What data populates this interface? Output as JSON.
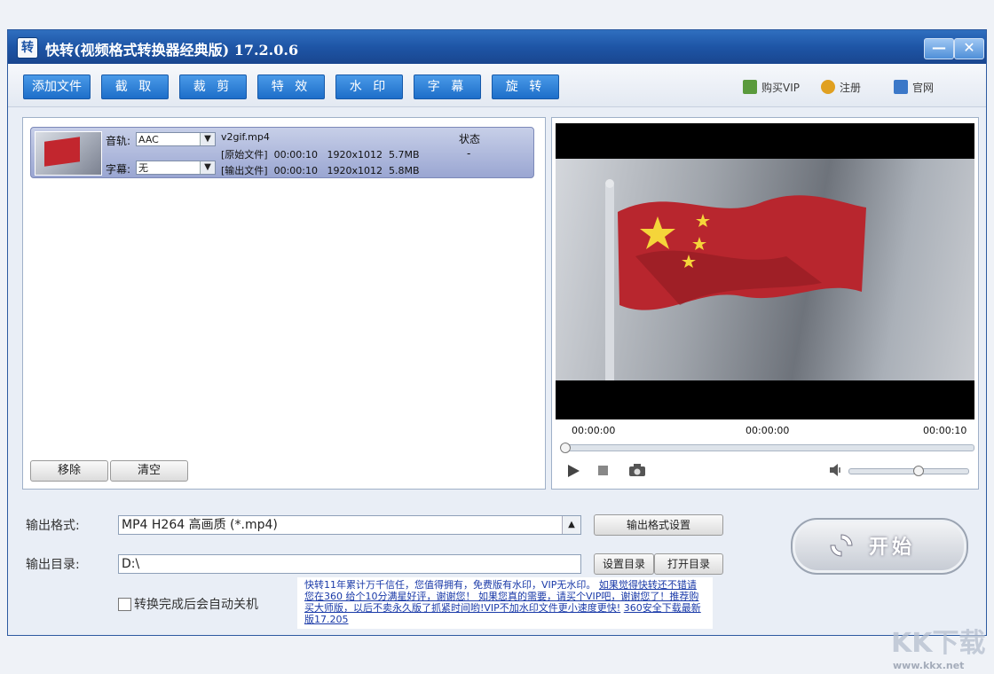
{
  "window": {
    "title": "快转(视频格式转换器经典版) 17.2.0.6",
    "app_icon_glyph": "转",
    "minimize_glyph": "—",
    "close_glyph": "✕"
  },
  "toolbar": {
    "buttons": [
      "添加文件",
      "截 取",
      "裁 剪",
      "特 效",
      "水 印",
      "字 幕",
      "旋 转"
    ],
    "links": [
      {
        "label": "购买VIP",
        "icon": "cart-icon"
      },
      {
        "label": "注册",
        "icon": "medal-icon"
      },
      {
        "label": "官网",
        "icon": "home-icon"
      }
    ]
  },
  "file_list": {
    "items": [
      {
        "audio_label": "音轨:",
        "audio_value": "AAC",
        "subtitle_label": "字幕:",
        "subtitle_value": "无",
        "filename": "v2gif.mp4",
        "source_info": "[原始文件]  00:00:10   1920x1012  5.7MB",
        "output_info": "[输出文件]  00:00:10   1920x1012  5.8MB",
        "status_header": "状态",
        "status_value": "-"
      }
    ],
    "remove_label": "移除",
    "clear_label": "清空"
  },
  "player": {
    "time_start": "00:00:00",
    "time_current": "00:00:00",
    "time_end": "00:00:10",
    "seek_fraction": 0.0,
    "volume_fraction": 0.5,
    "controls": [
      "play-icon",
      "stop-icon",
      "camera-icon",
      "speaker-icon"
    ]
  },
  "settings": {
    "format_label": "输出格式:",
    "format_value": "MP4  H264 高画质 (*.mp4)",
    "format_settings_button": "输出格式设置",
    "dir_label": "输出目录:",
    "dir_value": "D:\\",
    "set_dir_button": "设置目录",
    "open_dir_button": "打开目录",
    "shutdown_label": "转换完成后会自动关机",
    "shutdown_checked": false
  },
  "start_button": {
    "label": "开始"
  },
  "notice": {
    "text": "快转11年累计万千信任，您值得拥有，免费版有水印，VIP无水印。",
    "link1": "如果觉得快转还不错请您在360 给个10分满星好评，谢谢您！ 如果您真的需要，请买个VIP吧，谢谢您了！推荐购买大师版，以后不卖永久版了抓紧时间哟!VIP不加水印文件更小速度更快!",
    "link2": "360安全下载最新版17.205"
  },
  "watermark": {
    "big": "KK下载",
    "url": "www.kkx.net"
  },
  "colors": {
    "titlebar": "#1e55a6",
    "toolbar_button": "#1d6ec9",
    "notice_text": "#1a3aa8"
  }
}
